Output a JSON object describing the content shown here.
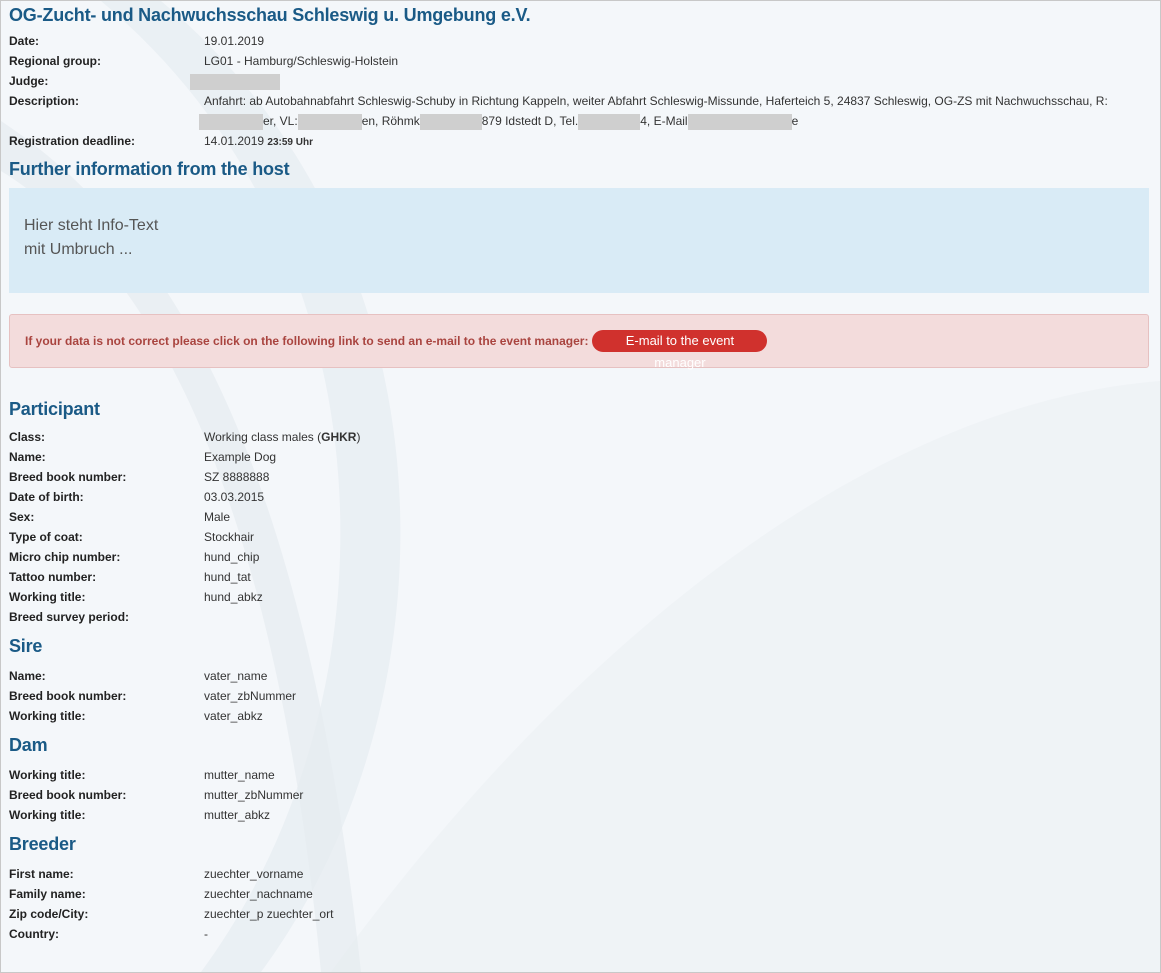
{
  "event": {
    "title": "OG-Zucht- und Nachwuchsschau Schleswig u. Umgebung e.V.",
    "labels": {
      "date": "Date:",
      "regional_group": "Regional group:",
      "judge": "Judge:",
      "description": "Description:",
      "deadline": "Registration deadline:"
    },
    "date": "19.01.2019",
    "regional_group": "LG01 - Hamburg/Schleswig-Holstein",
    "description_line1": "Anfahrt: ab Autobahnabfahrt Schleswig-Schuby in Richtung Kappeln, weiter Abfahrt Schleswig-Missunde, Haferteich 5, 24837 Schleswig, OG-ZS mit Nachwuchsschau, R:",
    "description_parts": {
      "p1": "er, VL:",
      "p2": "en, Röhmk",
      "p3": "879 Idstedt D, Tel.",
      "p4": "4, E-Mail",
      "p5": "e"
    },
    "deadline_date": "14.01.2019",
    "deadline_time": "23:59 Uhr"
  },
  "host_info": {
    "heading": "Further information from the host",
    "line1": "Hier steht Info-Text",
    "line2": "mit Umbruch ..."
  },
  "alert": {
    "text": "If your data is not correct please click on the following link to send an e-mail to the event manager:",
    "button": "E-mail to the event manager"
  },
  "participant": {
    "heading": "Participant",
    "rows": [
      {
        "label": "Class:",
        "value": "Working class males (",
        "bold": "GHKR",
        "after": ")"
      },
      {
        "label": "Name:",
        "value": "Example Dog"
      },
      {
        "label": "Breed book number:",
        "value": "SZ 8888888"
      },
      {
        "label": "Date of birth:",
        "value": "03.03.2015"
      },
      {
        "label": "Sex:",
        "value": "Male"
      },
      {
        "label": "Type of coat:",
        "value": "Stockhair"
      },
      {
        "label": "Micro chip number:",
        "value": "hund_chip"
      },
      {
        "label": "Tattoo number:",
        "value": "hund_tat"
      },
      {
        "label": "Working title:",
        "value": "hund_abkz"
      },
      {
        "label": "Breed survey period:",
        "value": ""
      }
    ]
  },
  "sire": {
    "heading": "Sire",
    "rows": [
      {
        "label": "Name:",
        "value": "vater_name"
      },
      {
        "label": "Breed book number:",
        "value": "vater_zbNummer"
      },
      {
        "label": "Working title:",
        "value": "vater_abkz"
      }
    ]
  },
  "dam": {
    "heading": "Dam",
    "rows": [
      {
        "label": "Working title:",
        "value": "mutter_name"
      },
      {
        "label": "Breed book number:",
        "value": "mutter_zbNummer"
      },
      {
        "label": "Working title:",
        "value": "mutter_abkz"
      }
    ]
  },
  "breeder": {
    "heading": "Breeder",
    "rows": [
      {
        "label": "First name:",
        "value": "zuechter_vorname"
      },
      {
        "label": "Family name:",
        "value": "zuechter_nachname"
      },
      {
        "label": "Zip code/City:",
        "value": "zuechter_p zuechter_ort"
      },
      {
        "label": "Country:",
        "value": "-"
      }
    ]
  }
}
